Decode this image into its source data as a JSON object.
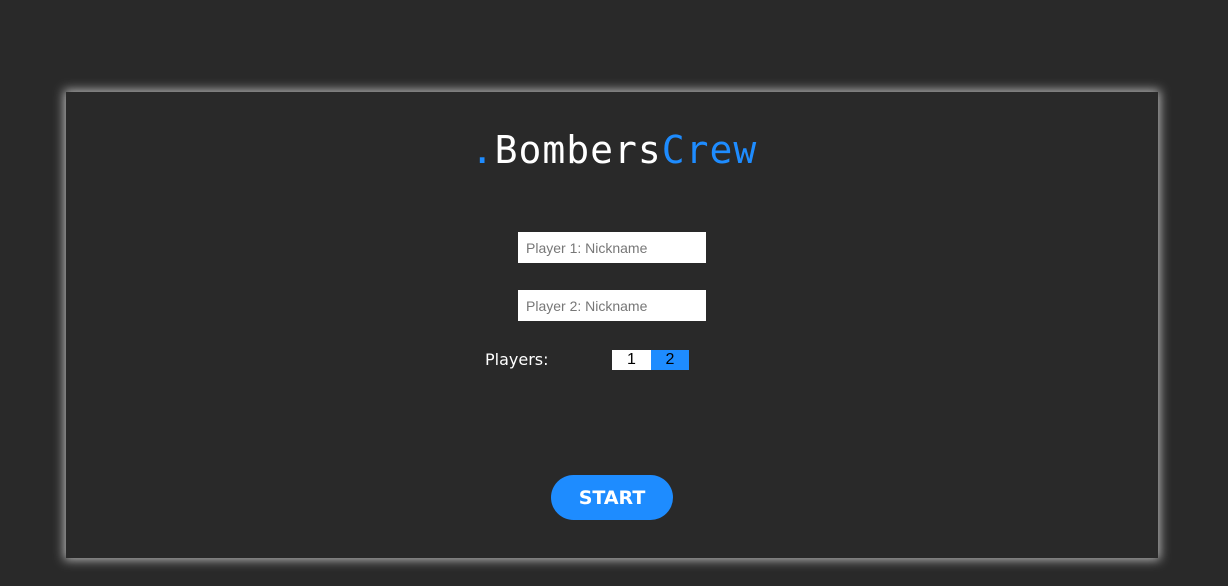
{
  "title": {
    "dot": ".",
    "main": "Bombers",
    "accent": "Crew"
  },
  "inputs": {
    "player1": {
      "placeholder": "Player 1: Nickname",
      "value": ""
    },
    "player2": {
      "placeholder": "Player 2: Nickname",
      "value": ""
    }
  },
  "players": {
    "label": "Players:",
    "options": [
      "1",
      "2"
    ],
    "selected": "2"
  },
  "start_label": "START",
  "colors": {
    "accent": "#1e8cff",
    "background": "#292929"
  }
}
